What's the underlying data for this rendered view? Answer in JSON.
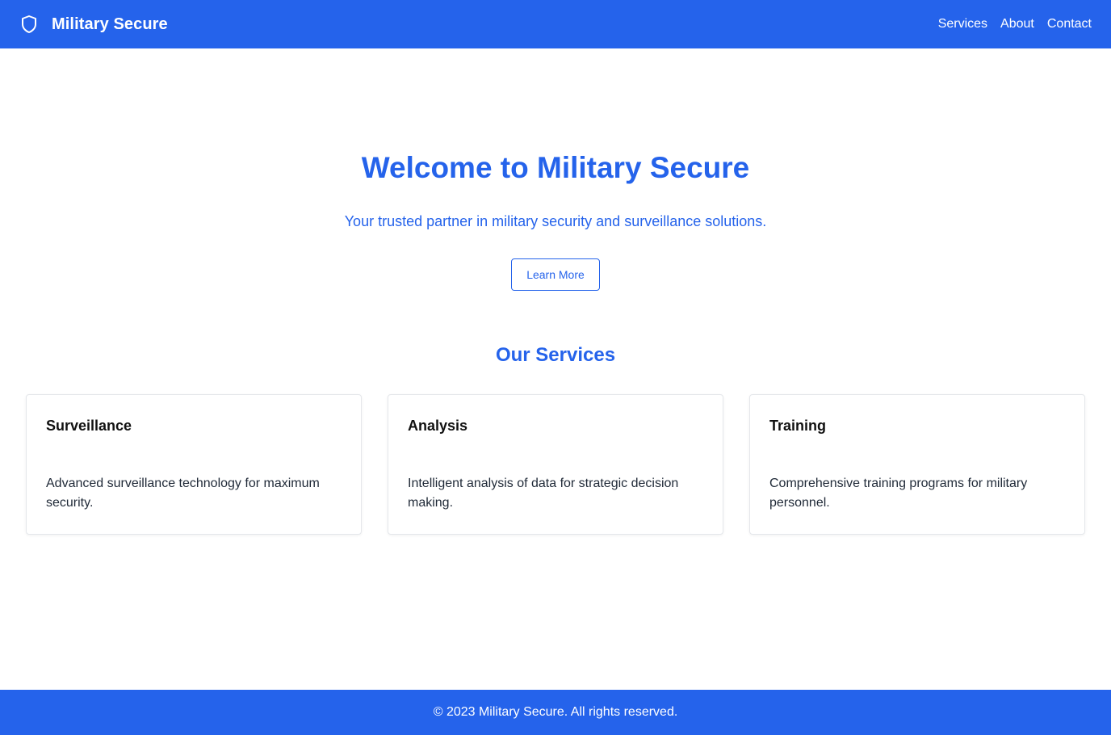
{
  "header": {
    "brand_icon": "shield-icon",
    "brand_name": "Military Secure",
    "nav": [
      {
        "label": "Services"
      },
      {
        "label": "About"
      },
      {
        "label": "Contact"
      }
    ]
  },
  "hero": {
    "title": "Welcome to Military Secure",
    "subtitle": "Your trusted partner in military security and surveillance solutions.",
    "button_label": "Learn More"
  },
  "services": {
    "title": "Our Services",
    "cards": [
      {
        "title": "Surveillance",
        "text": "Advanced surveillance technology for maximum security."
      },
      {
        "title": "Analysis",
        "text": "Intelligent analysis of data for strategic decision making."
      },
      {
        "title": "Training",
        "text": "Comprehensive training programs for military personnel."
      }
    ]
  },
  "footer": {
    "text": "© 2023 Military Secure. All rights reserved."
  },
  "colors": {
    "primary": "#2563eb",
    "background": "#ffffff",
    "card_border": "#e5e7eb",
    "text_dark": "#111111"
  }
}
